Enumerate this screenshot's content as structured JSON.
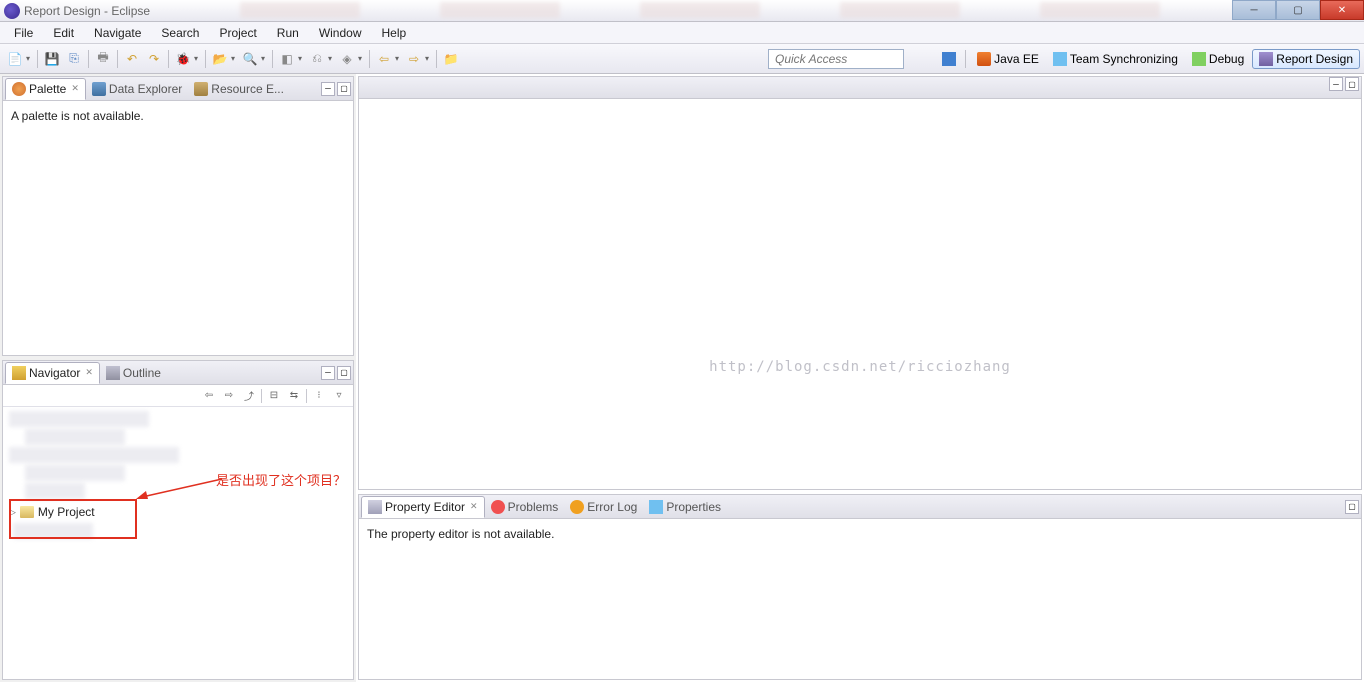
{
  "titlebar": {
    "title": "Report Design - Eclipse"
  },
  "menubar": {
    "items": [
      "File",
      "Edit",
      "Navigate",
      "Search",
      "Project",
      "Run",
      "Window",
      "Help"
    ]
  },
  "toolbar": {
    "quick_access_placeholder": "Quick Access"
  },
  "perspectives": {
    "java_ee": "Java EE",
    "team_sync": "Team Synchronizing",
    "debug": "Debug",
    "report_design": "Report Design"
  },
  "left_top": {
    "tabs": {
      "palette": "Palette",
      "data_explorer": "Data Explorer",
      "resource_explorer": "Resource E..."
    },
    "body_text": "A palette is not available."
  },
  "left_bottom": {
    "tabs": {
      "navigator": "Navigator",
      "outline": "Outline"
    },
    "project_name": "My Project"
  },
  "watermark": "http://blog.csdn.net/ricciozhang",
  "bottom_panel": {
    "tabs": {
      "property_editor": "Property Editor",
      "problems": "Problems",
      "error_log": "Error Log",
      "properties": "Properties"
    },
    "body_text": "The property editor is not available."
  },
  "annotation": {
    "text": "是否出现了这个项目？"
  }
}
